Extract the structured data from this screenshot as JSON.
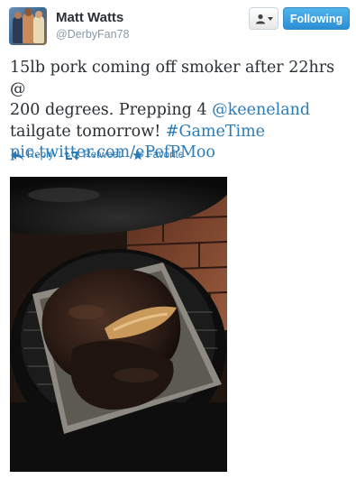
{
  "user": {
    "name": "Matt Watts",
    "handle": "@DerbyFan78"
  },
  "buttons": {
    "following_label": "Following",
    "user_menu_icon": "user-dropdown-icon"
  },
  "tweet": {
    "line1": "15lb pork coming off smoker after 22hrs @",
    "line2_text": "200 degrees. Prepping 4 ",
    "mention": "@keeneland",
    "line3_text": "tailgate tomorrow! ",
    "hashtag": "#GameTime",
    "link": "pic.twitter.com/ePefPMoo"
  },
  "actions": {
    "reply_label": "Reply",
    "retweet_label": "Retweet",
    "favorite_label": "Favorite"
  },
  "colors": {
    "link": "#2b7bb9",
    "follow_button": "#2b8ed6",
    "name": "#292f33",
    "handle": "#8899a6"
  }
}
